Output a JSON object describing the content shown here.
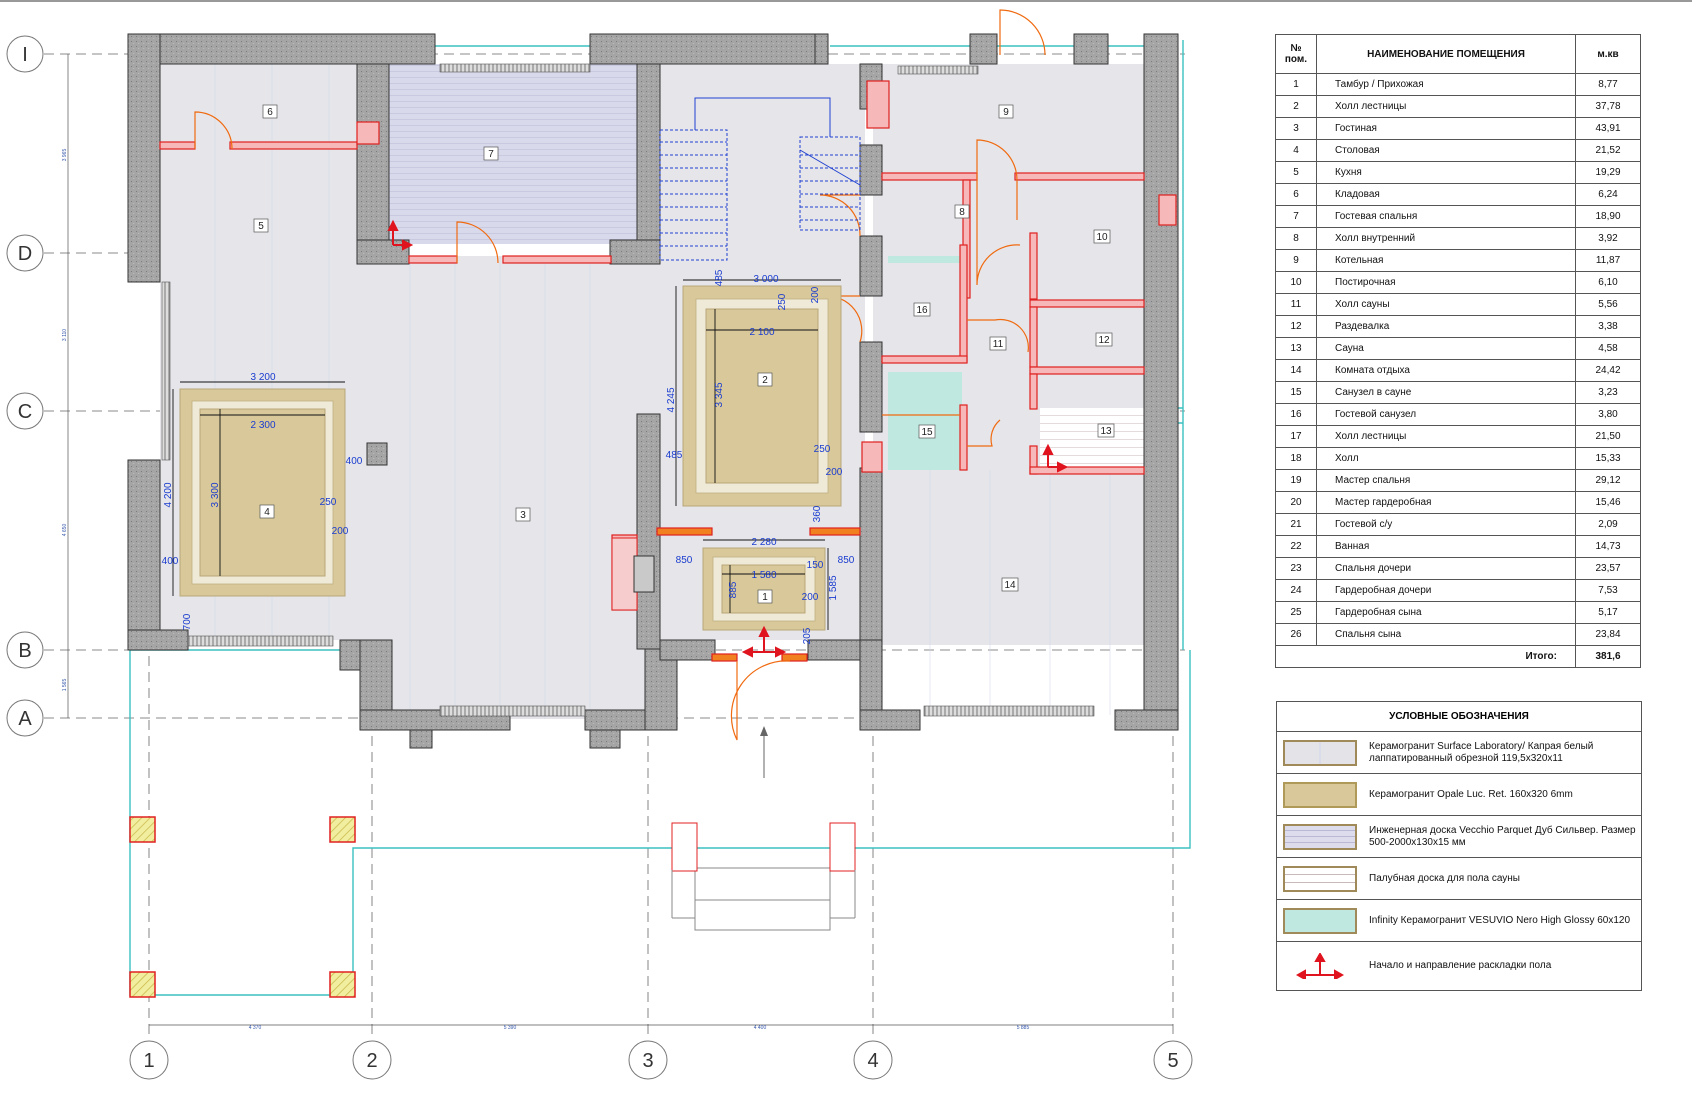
{
  "axes_rows": [
    "I",
    "D",
    "C",
    "B",
    "A"
  ],
  "axes_cols": [
    "1",
    "2",
    "3",
    "4",
    "5"
  ],
  "room_numbers": [
    "1",
    "2",
    "3",
    "4",
    "5",
    "6",
    "7",
    "8",
    "9",
    "10",
    "11",
    "12",
    "13",
    "14",
    "15",
    "16"
  ],
  "dimensions": {
    "d3000": "3 000",
    "d2100": "2 100",
    "d3200": "3 200",
    "d2300": "2 300",
    "d4245": "4 245",
    "d3345": "3 345",
    "d4200": "4 200",
    "d3300": "3 300",
    "d2280": "2 280",
    "d1580": "1 580",
    "d1585": "1 585",
    "d885": "885",
    "d485a": "485",
    "d485b": "485",
    "d250a": "250",
    "d200a": "200",
    "d250b": "250",
    "d200b": "200",
    "d250c": "250",
    "d200c": "200",
    "d400a": "400",
    "d400b": "400",
    "d700": "700",
    "d360": "360",
    "d850a": "850",
    "d850b": "850",
    "d150": "150",
    "d200d": "200",
    "d205": "205"
  },
  "small_dims": {
    "bottom": [
      "4 370",
      "5 390",
      "4 400",
      "5 885"
    ],
    "left": [
      "3 965",
      "3 110",
      "4 650",
      "1 565"
    ]
  },
  "table": {
    "col_num": "№ пом.",
    "col_name": "НАИМЕНОВАНИЕ ПОМЕЩЕНИЯ",
    "col_area": "м.кв",
    "rows": [
      {
        "n": "1",
        "name": "Тамбур / Прихожая",
        "area": "8,77"
      },
      {
        "n": "2",
        "name": "Холл лестницы",
        "area": "37,78"
      },
      {
        "n": "3",
        "name": "Гостиная",
        "area": "43,91"
      },
      {
        "n": "4",
        "name": "Столовая",
        "area": "21,52"
      },
      {
        "n": "5",
        "name": "Кухня",
        "area": "19,29"
      },
      {
        "n": "6",
        "name": "Кладовая",
        "area": "6,24"
      },
      {
        "n": "7",
        "name": "Гостевая спальня",
        "area": "18,90"
      },
      {
        "n": "8",
        "name": "Холл внутренний",
        "area": "3,92"
      },
      {
        "n": "9",
        "name": "Котельная",
        "area": "11,87"
      },
      {
        "n": "10",
        "name": "Постирочная",
        "area": "6,10"
      },
      {
        "n": "11",
        "name": "Холл сауны",
        "area": "5,56"
      },
      {
        "n": "12",
        "name": "Раздевалка",
        "area": "3,38"
      },
      {
        "n": "13",
        "name": "Сауна",
        "area": "4,58"
      },
      {
        "n": "14",
        "name": "Комната отдыха",
        "area": "24,42"
      },
      {
        "n": "15",
        "name": "Санузел в сауне",
        "area": "3,23"
      },
      {
        "n": "16",
        "name": "Гостевой санузел",
        "area": "3,80"
      },
      {
        "n": "17",
        "name": "Холл лестницы",
        "area": "21,50"
      },
      {
        "n": "18",
        "name": "Холл",
        "area": "15,33"
      },
      {
        "n": "19",
        "name": "Мастер спальня",
        "area": "29,12"
      },
      {
        "n": "20",
        "name": "Мастер гардеробная",
        "area": "15,46"
      },
      {
        "n": "21",
        "name": "Гостевой с/у",
        "area": "2,09"
      },
      {
        "n": "22",
        "name": "Ванная",
        "area": "14,73"
      },
      {
        "n": "23",
        "name": "Спальня дочери",
        "area": "23,57"
      },
      {
        "n": "24",
        "name": "Гардеробная дочери",
        "area": "7,53"
      },
      {
        "n": "25",
        "name": "Гардеробная сына",
        "area": "5,17"
      },
      {
        "n": "26",
        "name": "Спальня сына",
        "area": "23,84"
      }
    ],
    "total_label": "Итого:",
    "total_value": "381,6"
  },
  "legend": {
    "title": "УСЛОВНЫЕ ОБОЗНАЧЕНИЯ",
    "items": [
      {
        "text": "Керамогранит Surface Laboratory/ Капрая белый лаппатированный обрезной 119,5х320х11",
        "color": "#e4e4e8",
        "icon": "grey-tile-swatch"
      },
      {
        "text": "Керамогранит Opale Luc. Ret. 160x320 6mm",
        "color": "#d8c89a",
        "icon": "beige-tile-swatch"
      },
      {
        "text": "Инженерная доска Vecchio Parquet Дуб Сильвер. Размер 500-2000х130х15 мм",
        "color": "#dcdcec",
        "icon": "parquet-swatch"
      },
      {
        "text": "Палубная доска для пола сауны",
        "color": "#ffffff",
        "icon": "deck-board-swatch"
      },
      {
        "text": "Infinity Керамогранит VESUVIO Nero High Glossy 60x120",
        "color": "#bfe9e0",
        "icon": "glossy-tile-swatch"
      },
      {
        "text": "Начало и направление раскладки пола",
        "color": "#e0141e",
        "icon": "layout-direction-arrow-icon"
      }
    ]
  },
  "colors": {
    "wall_fill": "#9a9a9a",
    "floor_grey": "#e6e6ea",
    "floor_beige": "#d8c89a",
    "parquet": "#d9d9ec",
    "glossy": "#bfe9e0",
    "partition": "#e02020",
    "outline_cyan": "#3cc0c0"
  }
}
